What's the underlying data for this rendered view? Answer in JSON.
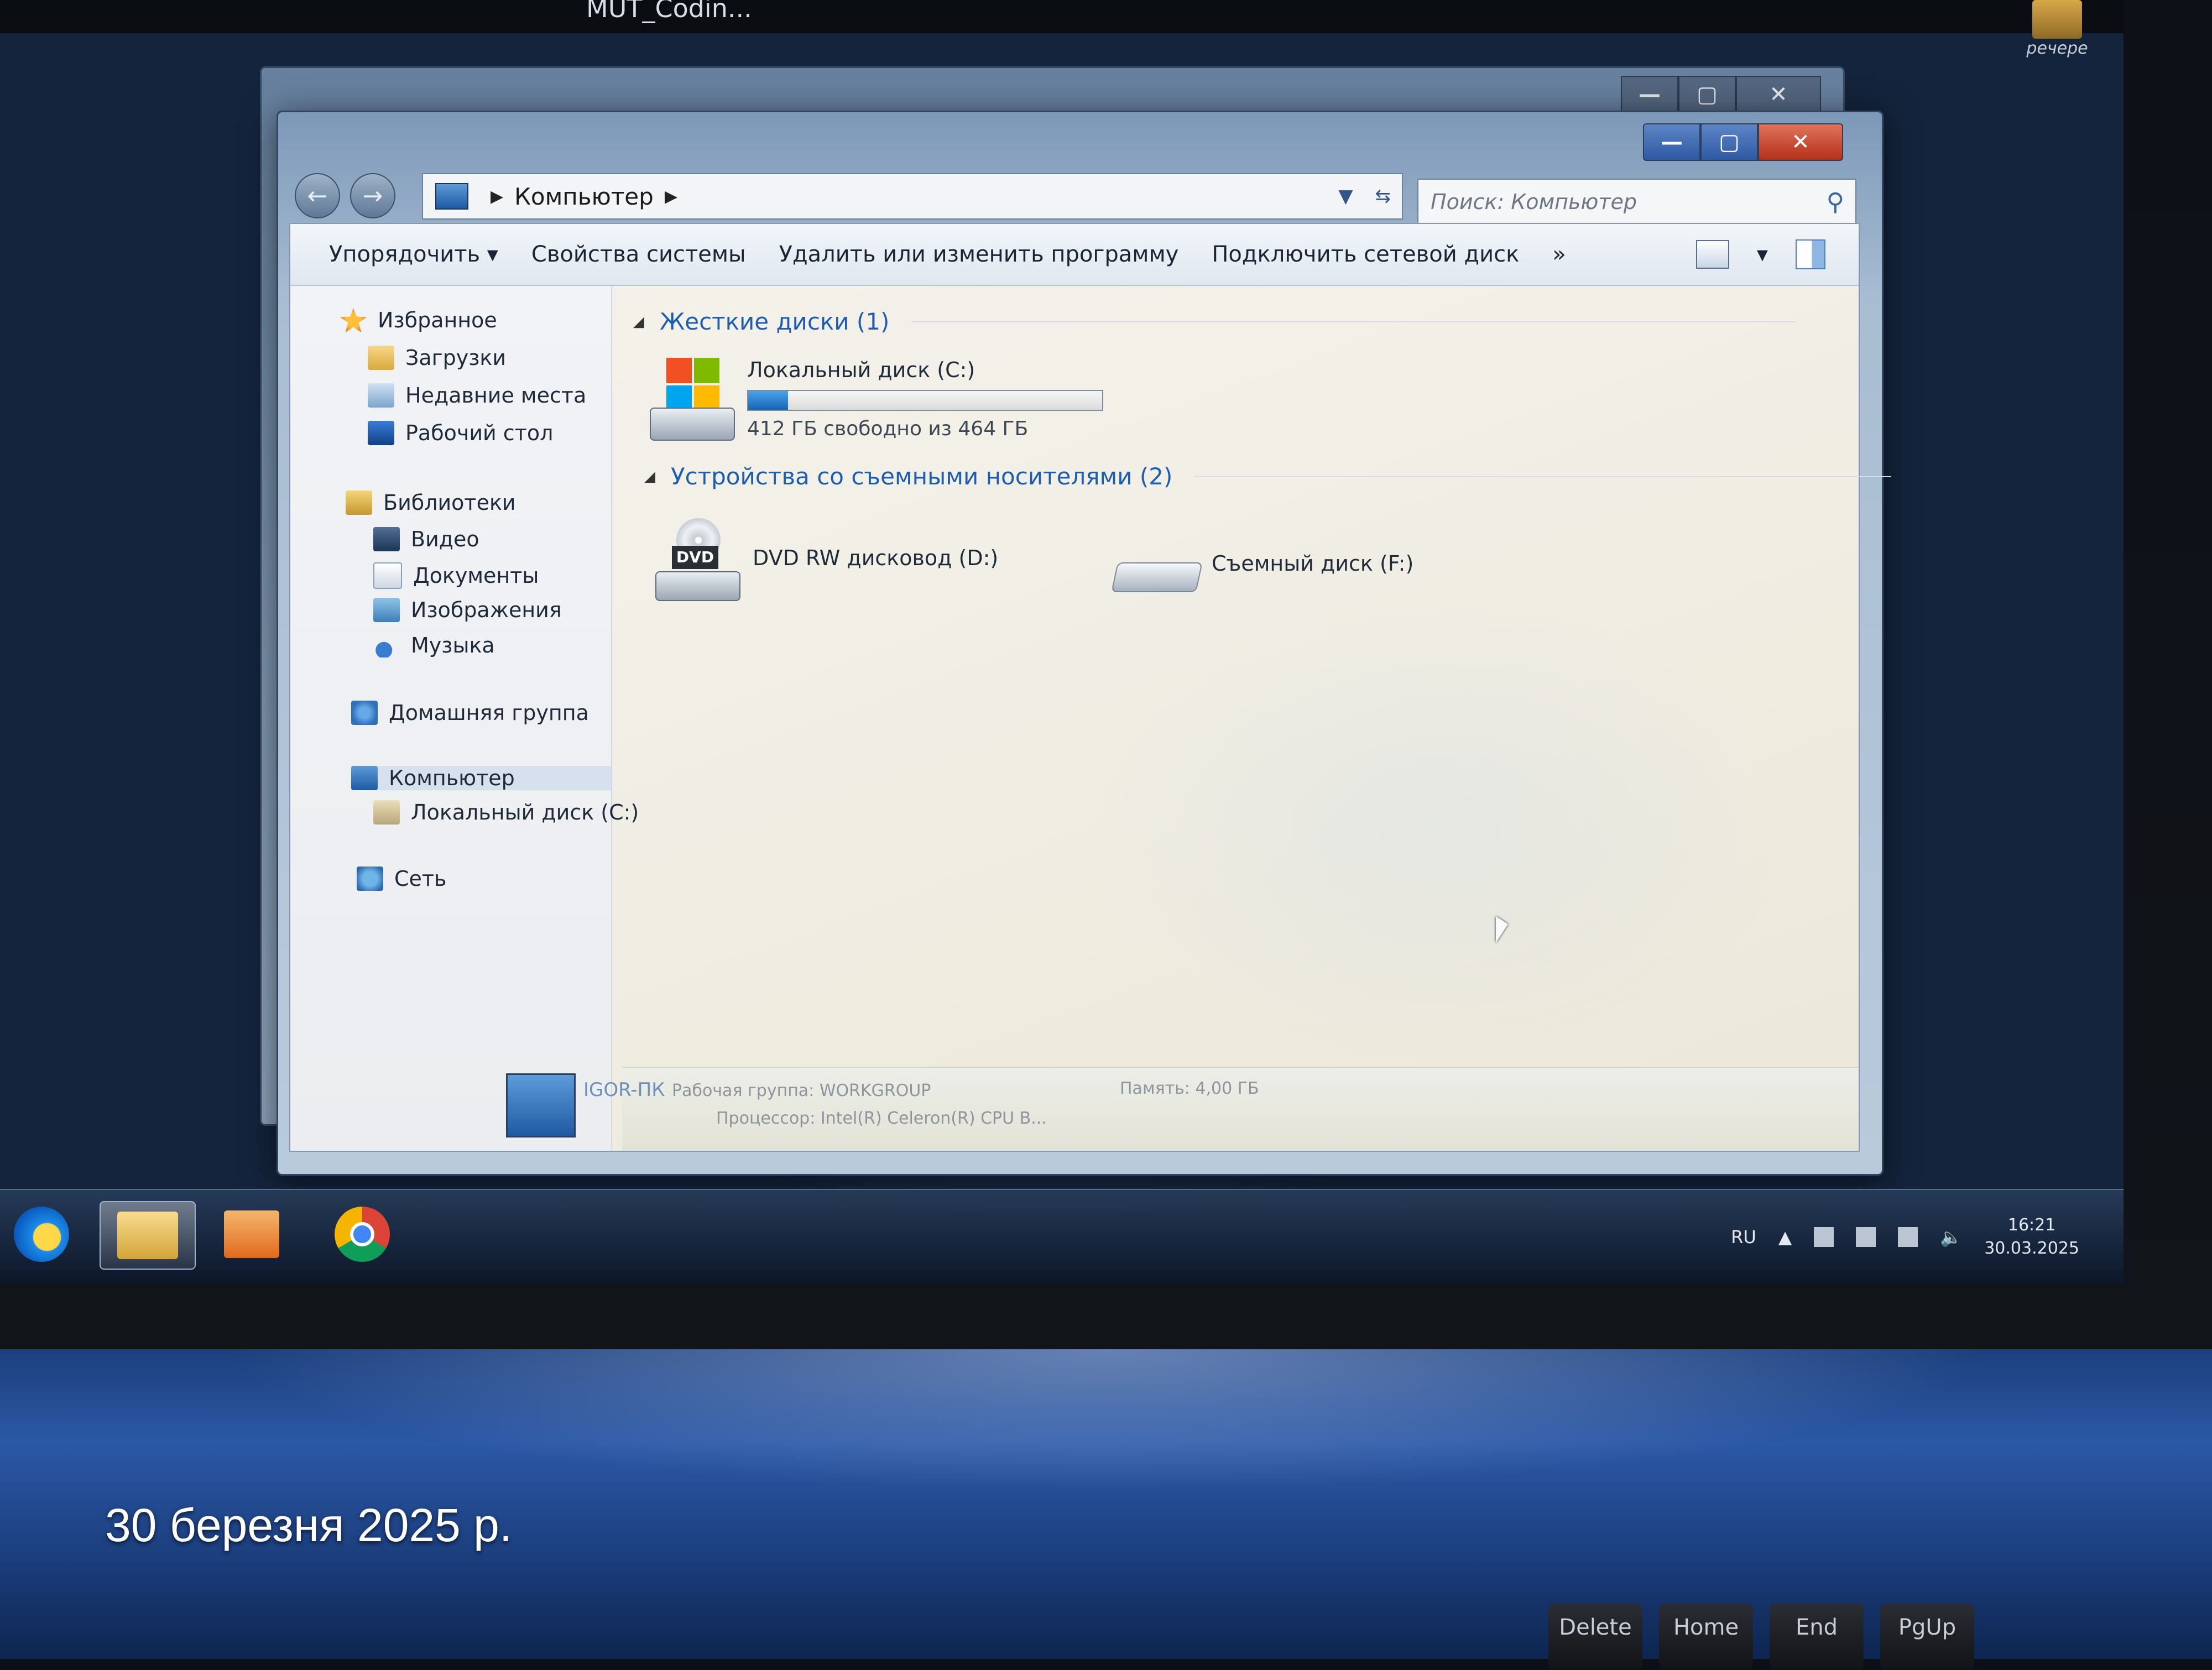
{
  "desktop": {
    "top_labels": [
      "MUT_Codin..."
    ],
    "corner_icon_label": "речере"
  },
  "window": {
    "address_path": "Компьютер",
    "search_placeholder": "Поиск: Компьютер",
    "toolbar": {
      "organize": "Упорядочить",
      "system_properties": "Свойства системы",
      "uninstall": "Удалить или изменить программу",
      "map_drive": "Подключить сетевой диск",
      "more": "»"
    },
    "nav": {
      "favorites": "Избранное",
      "downloads": "Загрузки",
      "recent": "Недавние места",
      "desktop": "Рабочий стол",
      "libraries": "Библиотеки",
      "video": "Видео",
      "documents": "Документы",
      "images": "Изображения",
      "music": "Музыка",
      "homegroup": "Домашняя группа",
      "computer": "Компьютер",
      "local_disk": "Локальный диск (C:)",
      "network": "Сеть"
    },
    "groups": {
      "hard_drives": "Жесткие диски (1)",
      "removable": "Устройства со съемными носителями (2)"
    },
    "drives": {
      "c_name": "Локальный диск (C:)",
      "c_free": "412 ГБ свободно из 464 ГБ",
      "c_used_fraction": 0.112,
      "d_name": "DVD RW дисковод (D:)",
      "d_badge": "DVD",
      "f_name": "Съемный диск (F:)"
    },
    "details": {
      "pc_name": "IGOR-ПК",
      "workgroup": "Рабочая группа: WORKGROUP",
      "memory": "Память: 4,00 ГБ",
      "cpu": "Процессор: Intel(R) Celeron(R) CPU B..."
    }
  },
  "taskbar": {
    "lang": "RU",
    "time": "16:21",
    "date": "30.03.2025"
  },
  "keyboard": {
    "keys": [
      "Delete",
      "Home",
      "End",
      "PgUp"
    ]
  },
  "photo_timestamp": "30 березня 2025 р."
}
